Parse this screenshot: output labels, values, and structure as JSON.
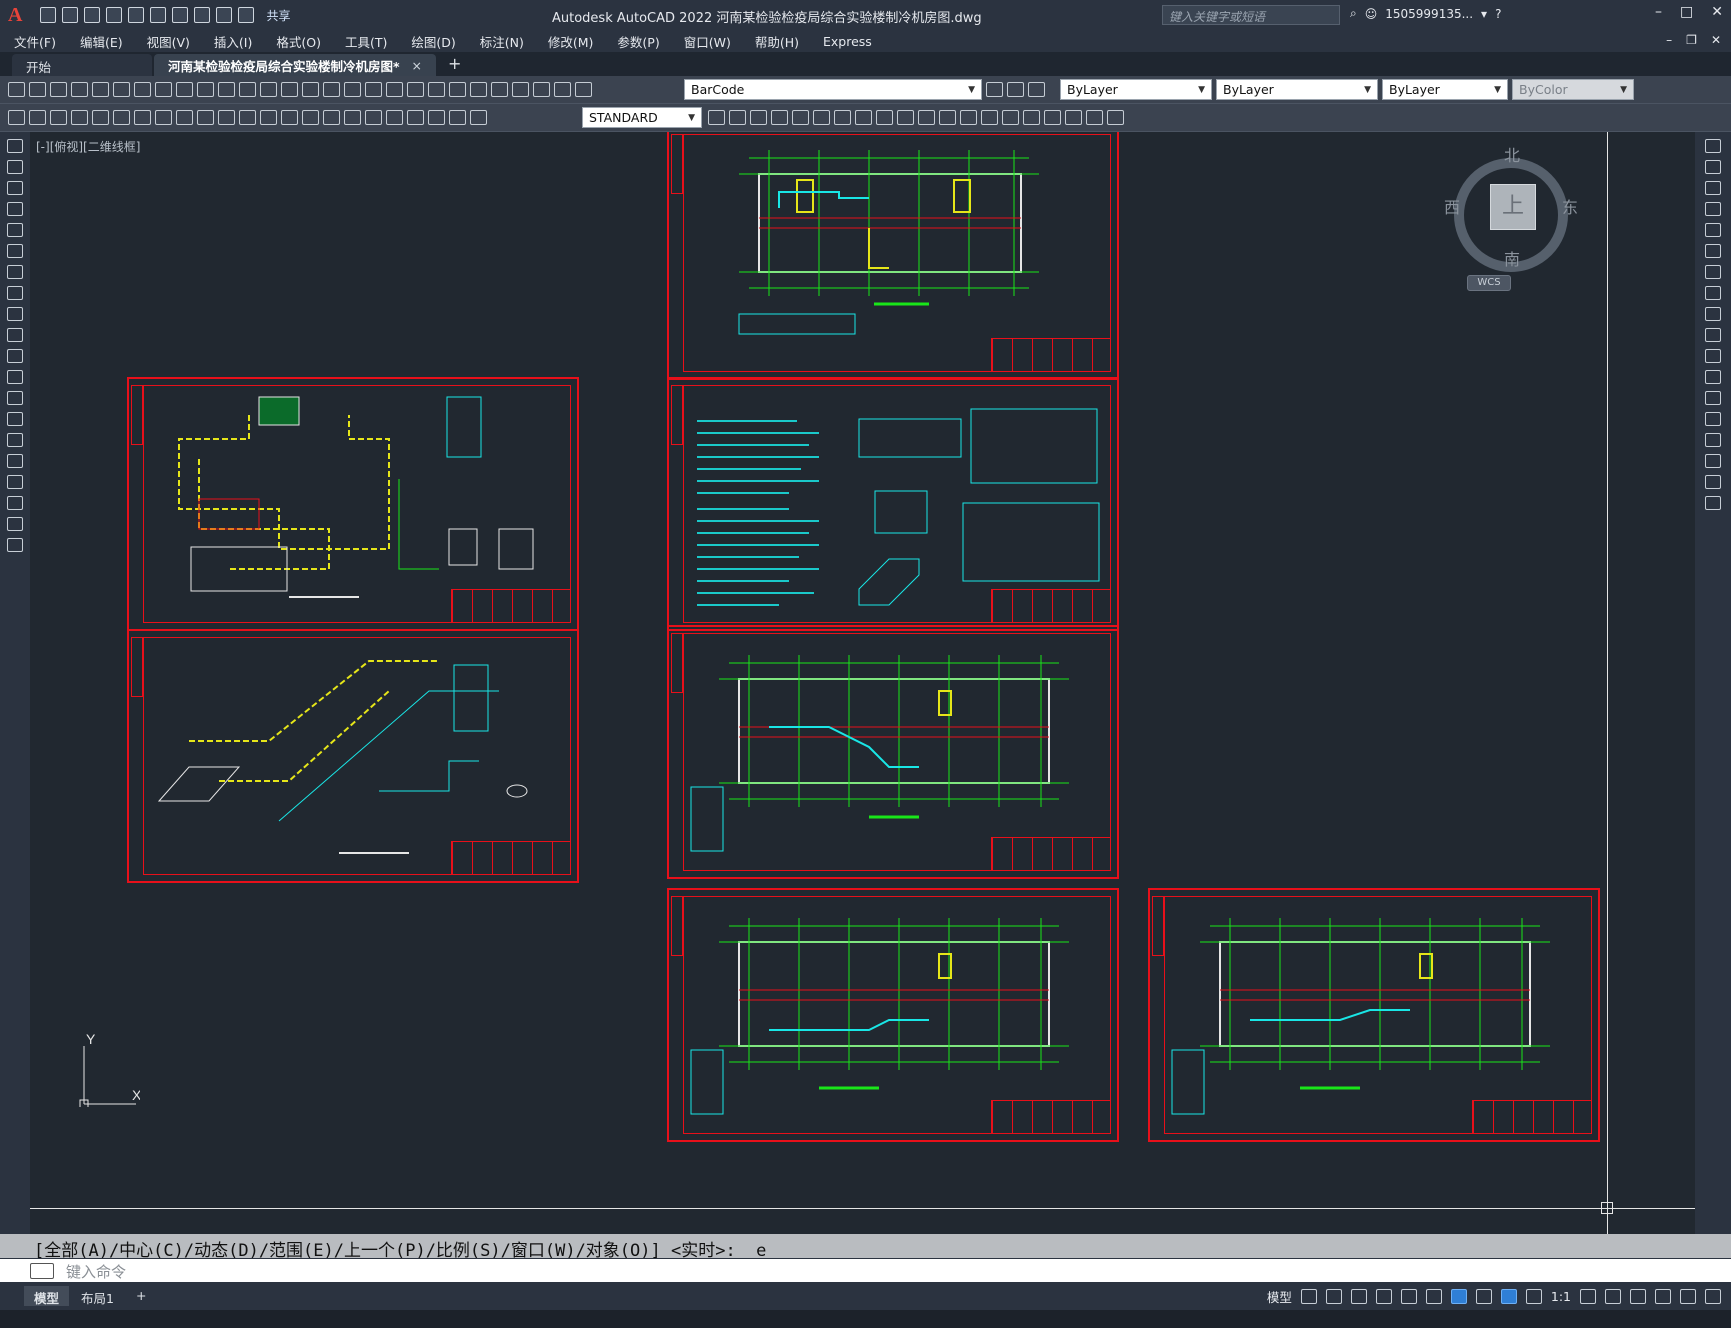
{
  "app": {
    "logo": "A",
    "share_label": "共享",
    "title": "Autodesk AutoCAD 2022    河南某检验检疫局综合实验楼制冷机房图.dwg",
    "search_placeholder": "键入关键字或短语",
    "user": "1505999135...",
    "help": "?"
  },
  "menu": [
    "文件(F)",
    "编辑(E)",
    "视图(V)",
    "插入(I)",
    "格式(O)",
    "工具(T)",
    "绘图(D)",
    "标注(N)",
    "修改(M)",
    "参数(P)",
    "窗口(W)",
    "帮助(H)",
    "Express"
  ],
  "tabs": {
    "start": "开始",
    "active": "河南某检验检疫局综合实验楼制冷机房图*",
    "close": "×",
    "add": "+"
  },
  "toolbar": {
    "layer": "BarCode",
    "color": "ByLayer",
    "linetype": "ByLayer",
    "lineweight": "ByLayer",
    "plotstyle": "ByColor",
    "textstyle": "STANDARD"
  },
  "viewport": {
    "label": "[-][俯视][二维线框]"
  },
  "viewcube": {
    "north": "北",
    "south": "南",
    "east": "东",
    "west": "西",
    "face": "上",
    "wcs": "WCS"
  },
  "ucs": {
    "x": "X",
    "y": "Y"
  },
  "command": {
    "history": "[全部(A)/中心(C)/动态(D)/范围(E)/上一个(P)/比例(S)/窗口(W)/对象(O)] <实时>: _e",
    "placeholder": "键入命令"
  },
  "status": {
    "model_tab": "模型",
    "layout_tab": "布局1",
    "add_tab": "+",
    "model_label": "模型",
    "scale": "1:1"
  },
  "colors": {
    "background": "#212830",
    "frame": "#e8101a",
    "grid": "#19e619",
    "wall": "#e6e6e6",
    "duct": "#19e6e6",
    "pipe": "#e6e619"
  }
}
